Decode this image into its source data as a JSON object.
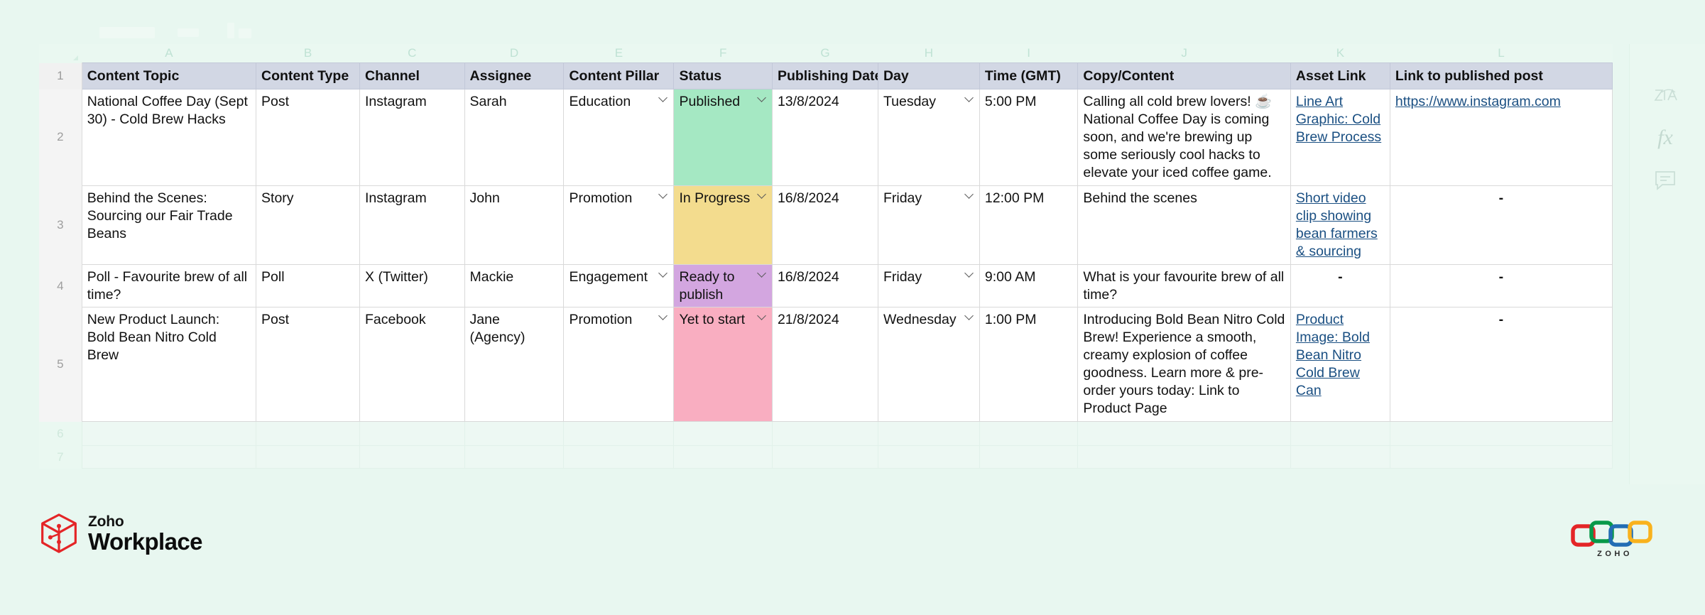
{
  "app": {
    "product_name_line1": "Zoho",
    "product_name_line2": "Workplace",
    "logo_wordmark": "ZOHO"
  },
  "rail": {
    "zia_label": "Zia",
    "fx_label": "fx",
    "comment_label": "Comments"
  },
  "grid": {
    "column_letters": [
      "A",
      "B",
      "C",
      "D",
      "E",
      "F",
      "G",
      "H",
      "I",
      "J",
      "K",
      "L"
    ],
    "row_numbers": [
      "1",
      "2",
      "3",
      "4",
      "5",
      "6",
      "7"
    ],
    "headers": [
      "Content Topic",
      "Content Type",
      "Channel",
      "Assignee",
      "Content Pillar",
      "Status",
      "Publishing Date",
      "Day",
      "Time (GMT)",
      "Copy/Content",
      "Asset Link",
      "Link to published post"
    ],
    "status_colors": {
      "Published": "#a5e8c3",
      "In Progress": "#f3dc8e",
      "Ready to publish": "#d3a6e0",
      "Yet to start": "#f9aec1"
    },
    "rows": [
      {
        "row_number": "2",
        "content_topic": "National Coffee Day (Sept 30) - Cold Brew Hacks",
        "content_type": "Post",
        "channel": "Instagram",
        "assignee": "Sarah",
        "content_pillar": "Education",
        "status": "Published",
        "publishing_date": "13/8/2024",
        "day": "Tuesday",
        "time_gmt": "5:00 PM",
        "copy_content": "Calling all cold brew lovers! ☕ National Coffee Day is coming soon, and we're brewing up some seriously cool hacks to elevate your iced coffee game.",
        "asset_link": "Line Art Graphic: Cold Brew Process",
        "published_post_link": "https://www.instagram.com"
      },
      {
        "row_number": "3",
        "content_topic": "Behind the Scenes: Sourcing our Fair Trade Beans",
        "content_type": "Story",
        "channel": "Instagram",
        "assignee": "John",
        "content_pillar": "Promotion",
        "status": "In Progress",
        "publishing_date": "16/8/2024",
        "day": "Friday",
        "time_gmt": "12:00 PM",
        "copy_content": "Behind the scenes",
        "asset_link": "Short video clip showing bean farmers & sourcing",
        "published_post_link": "-"
      },
      {
        "row_number": "4",
        "content_topic": "Poll - Favourite brew of all time?",
        "content_type": "Poll",
        "channel": "X (Twitter)",
        "assignee": "Mackie",
        "content_pillar": "Engagement",
        "status": "Ready to publish",
        "publishing_date": "16/8/2024",
        "day": "Friday",
        "time_gmt": "9:00 AM",
        "copy_content": "What is your favourite brew of all time?",
        "asset_link": "-",
        "published_post_link": "-"
      },
      {
        "row_number": "5",
        "content_topic": "New Product Launch: Bold Bean Nitro Cold Brew",
        "content_type": "Post",
        "channel": "Facebook",
        "assignee": "Jane (Agency)",
        "content_pillar": "Promotion",
        "status": "Yet to start",
        "publishing_date": "21/8/2024",
        "day": "Wednesday",
        "time_gmt": "1:00 PM",
        "copy_content": "Introducing Bold Bean Nitro Cold Brew! Experience a smooth, creamy explosion of coffee goodness. Learn more & pre-order yours today:  Link to Product Page",
        "asset_link": "Product Image: Bold Bean Nitro Cold Brew Can",
        "published_post_link": "-"
      }
    ],
    "empty_rows": [
      "6",
      "7"
    ]
  },
  "colors": {
    "page_background": "#e8f7f0",
    "header_row": "#d2d7e4",
    "link": "#1a4f82",
    "brand_red": "#e42527",
    "logo_red": "#e42527",
    "logo_green": "#089949",
    "logo_blue": "#226db4",
    "logo_yellow": "#f9b21d"
  }
}
